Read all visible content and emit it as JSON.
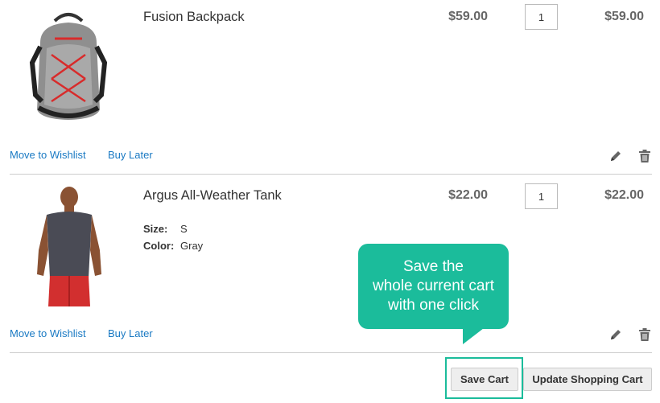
{
  "cart": {
    "items": [
      {
        "name": "Fusion Backpack",
        "price": "$59.00",
        "qty": "1",
        "subtotal": "$59.00",
        "options": [],
        "actions": {
          "wishlist": "Move to Wishlist",
          "later": "Buy Later"
        }
      },
      {
        "name": "Argus All-Weather Tank",
        "price": "$22.00",
        "qty": "1",
        "subtotal": "$22.00",
        "options": [
          {
            "label": "Size:",
            "value": "S"
          },
          {
            "label": "Color:",
            "value": "Gray"
          }
        ],
        "actions": {
          "wishlist": "Move to Wishlist",
          "later": "Buy Later"
        }
      }
    ]
  },
  "tooltip": {
    "lines": [
      "Save the",
      "whole current cart",
      "with one click"
    ]
  },
  "buttons": {
    "save_cart": "Save Cart",
    "update_cart": "Update Shopping Cart"
  },
  "icons": {
    "edit": "pencil-icon",
    "delete": "trash-icon"
  },
  "colors": {
    "link": "#1979c3",
    "accent": "#1bbc9b",
    "price": "#666666"
  }
}
